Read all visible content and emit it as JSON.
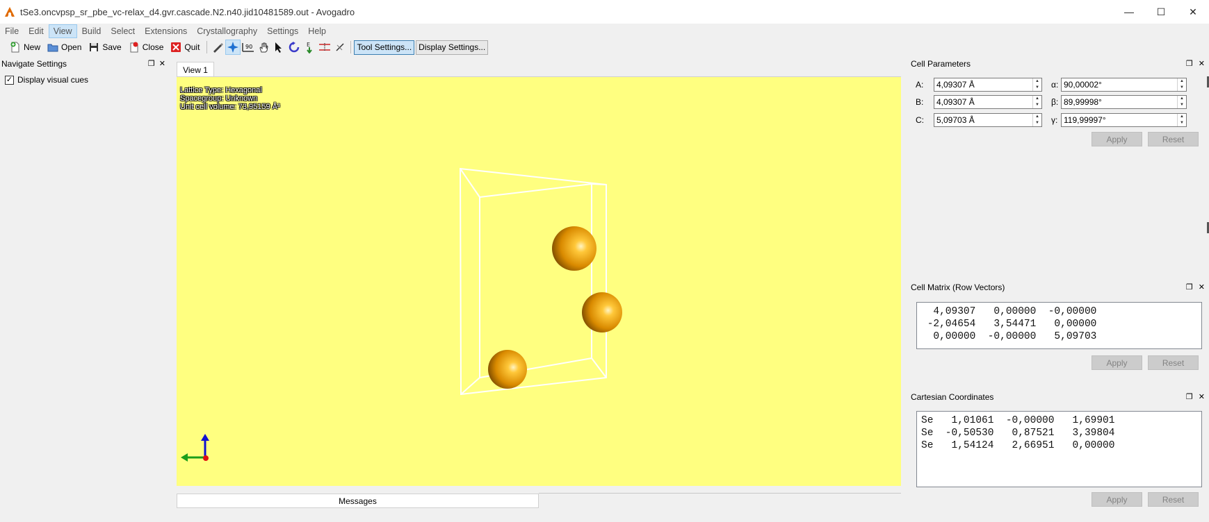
{
  "window": {
    "title": "tSe3.oncvpsp_sr_pbe_vc-relax_d4.gvr.cascade.N2.n40.jid10481589.out - Avogadro",
    "minimize": "—",
    "maximize": "☐",
    "close": "✕"
  },
  "menu": {
    "items": [
      "File",
      "Edit",
      "View",
      "Build",
      "Select",
      "Extensions",
      "Crystallography",
      "Settings",
      "Help"
    ],
    "active": "View"
  },
  "toolbar": {
    "new_label": "New",
    "open_label": "Open",
    "save_label": "Save",
    "close_label": "Close",
    "quit_label": "Quit",
    "tool_settings_label": "Tool Settings...",
    "display_settings_label": "Display Settings..."
  },
  "navigate_dock": {
    "title": "Navigate Settings",
    "display_visual_cues_label": "Display visual cues",
    "display_visual_cues_checked": true
  },
  "view": {
    "tab_label": "View 1",
    "lattice_type": "Lattice Type: Hexagonal",
    "spacegroup": "Spacegroup: Unknown",
    "unit_cell_volume": "Unit cell volume: 73,95159 Å³",
    "background_color": "#ffff80",
    "atom_color": "#e8a000"
  },
  "messages_tab": {
    "label": "Messages"
  },
  "cell_parameters": {
    "title": "Cell Parameters",
    "a_label": "A:",
    "a_value": "4,09307 Å",
    "b_label": "B:",
    "b_value": "4,09307 Å",
    "c_label": "C:",
    "c_value": "5,09703 Å",
    "alpha_label": "α:",
    "alpha_value": "90,00002°",
    "beta_label": "β:",
    "beta_value": "89,99998°",
    "gamma_label": "γ:",
    "gamma_value": "119,99997°",
    "apply_label": "Apply",
    "reset_label": "Reset"
  },
  "cell_matrix": {
    "title": "Cell Matrix (Row Vectors)",
    "text": "  4,09307   0,00000  -0,00000\n -2,04654   3,54471   0,00000\n  0,00000  -0,00000   5,09703",
    "apply_label": "Apply",
    "reset_label": "Reset"
  },
  "cartesian": {
    "title": "Cartesian Coordinates",
    "text": "Se   1,01061  -0,00000   1,69901\nSe  -0,50530   0,87521   3,39804\nSe   1,54124   2,66951   0,00000",
    "apply_label": "Apply",
    "reset_label": "Reset"
  }
}
